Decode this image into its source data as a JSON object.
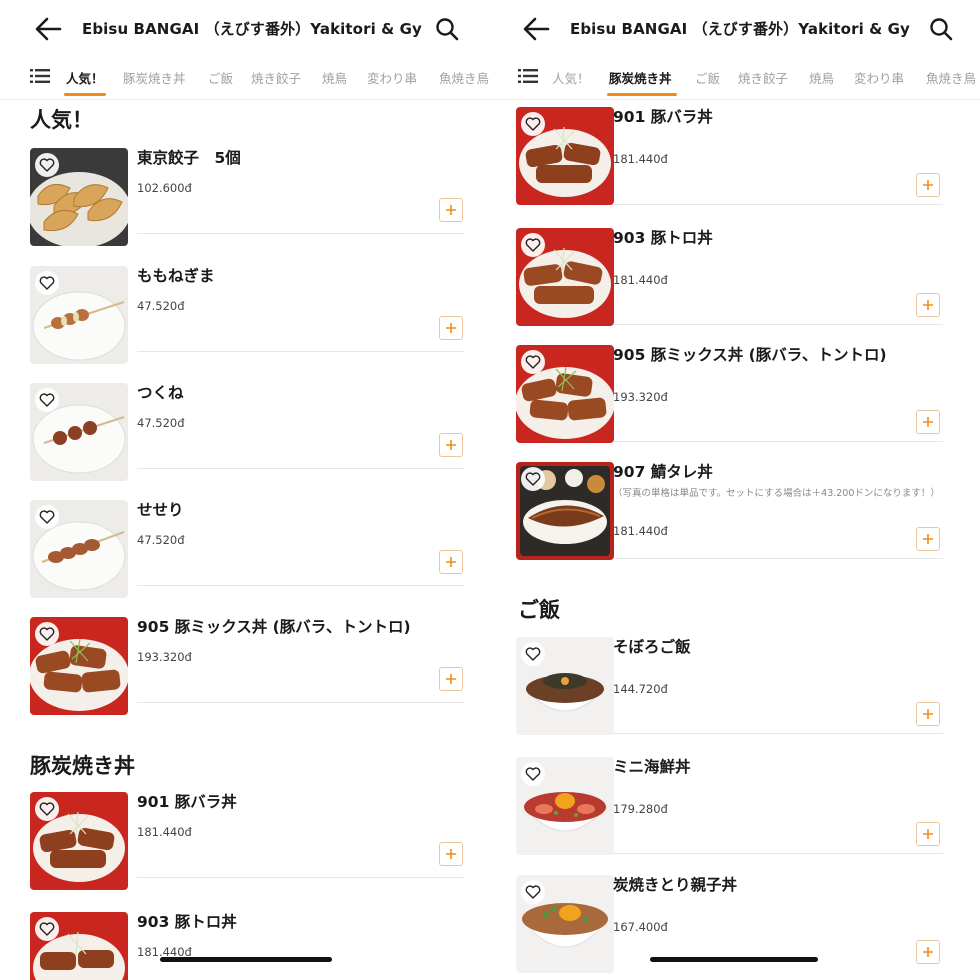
{
  "left": {
    "header": {
      "title": "Ebisu BANGAI （えびす番外）Yakitori & Gy..."
    },
    "tabs": [
      {
        "label": "人気！",
        "active": true
      },
      {
        "label": "豚炭焼き丼",
        "active": false
      },
      {
        "label": "ご飯",
        "active": false
      },
      {
        "label": "焼き餃子",
        "active": false
      },
      {
        "label": "焼鳥",
        "active": false
      },
      {
        "label": "変わり串",
        "active": false
      },
      {
        "label": "魚焼き鳥",
        "active": false
      }
    ],
    "sections": [
      {
        "title": "人気！",
        "items": [
          {
            "name": "東京餃子　5個",
            "price": "102.600đ",
            "image": "gyoza-photo"
          },
          {
            "name": "ももねぎま",
            "price": "47.520đ",
            "image": "yakitori-negima-photo"
          },
          {
            "name": "つくね",
            "price": "47.520đ",
            "image": "tsukune-photo"
          },
          {
            "name": "せせり",
            "price": "47.520đ",
            "image": "seseri-photo"
          },
          {
            "name": "905 豚ミックス丼 (豚バラ、トントロ)",
            "price": "193.320đ",
            "image": "pork-mix-don-photo"
          }
        ]
      },
      {
        "title": "豚炭焼き丼",
        "items": [
          {
            "name": "901 豚バラ丼",
            "price": "181.440đ",
            "image": "butabara-don-photo"
          },
          {
            "name": "903 豚トロ丼",
            "price": "181.440đ",
            "image": "butatoro-don-photo"
          }
        ]
      }
    ]
  },
  "right": {
    "header": {
      "title": "Ebisu BANGAI （えびす番外）Yakitori & Gy..."
    },
    "tabs": [
      {
        "label": "人気！",
        "active": false
      },
      {
        "label": "豚炭焼き丼",
        "active": true
      },
      {
        "label": "ご飯",
        "active": false
      },
      {
        "label": "焼き餃子",
        "active": false
      },
      {
        "label": "焼鳥",
        "active": false
      },
      {
        "label": "変わり串",
        "active": false
      },
      {
        "label": "魚焼き鳥",
        "active": false
      }
    ],
    "items_top": [
      {
        "name": "901 豚バラ丼",
        "price": "181.440đ",
        "image": "butabara-don-photo"
      },
      {
        "name": "903 豚トロ丼",
        "price": "181.440đ",
        "image": "butatoro-don-photo"
      },
      {
        "name": "905 豚ミックス丼 (豚バラ、トントロ)",
        "price": "193.320đ",
        "image": "pork-mix-don-photo"
      },
      {
        "name": "907 鯖タレ丼",
        "note": "（写真の単格は単品です。セットにする場合は＋43.200ドンになります！）",
        "price": "181.440đ",
        "image": "saba-tare-don-photo"
      }
    ],
    "section2": {
      "title": "ご飯",
      "items": [
        {
          "name": "そぼろご飯",
          "price": "144.720đ",
          "image": "soboro-gohan-photo"
        },
        {
          "name": "ミニ海鮮丼",
          "price": "179.280đ",
          "image": "mini-kaisen-don-photo"
        },
        {
          "name": "炭焼きとり親子丼",
          "price": "167.400đ",
          "image": "oyako-don-photo"
        }
      ]
    }
  },
  "colors": {
    "accent": "#f28c18",
    "inactive_tab": "#a0a0a0",
    "divider": "#e6e6e6"
  }
}
